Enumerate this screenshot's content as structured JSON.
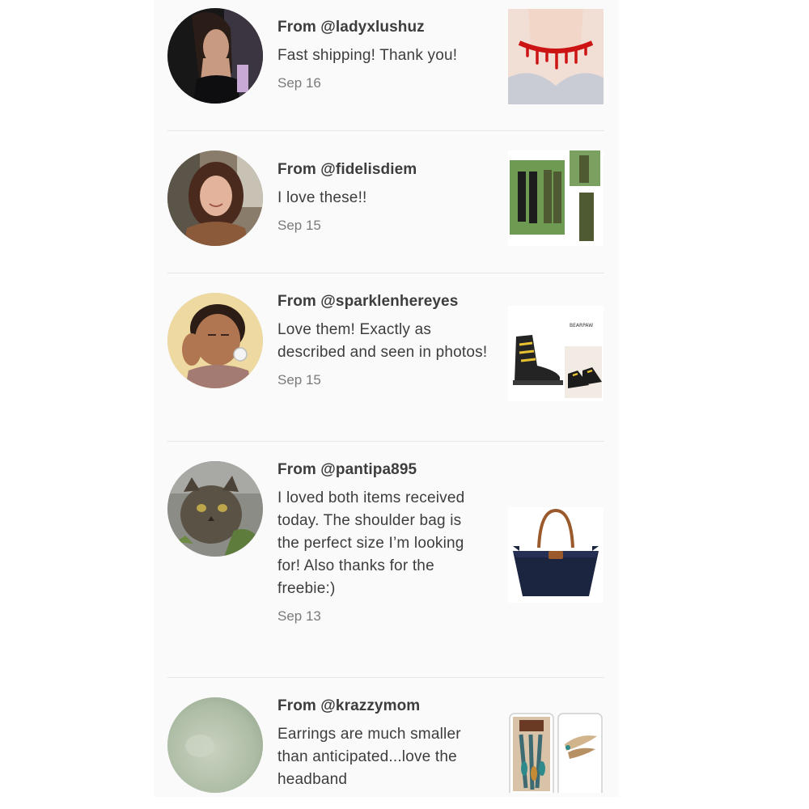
{
  "reviews": [
    {
      "from": "From @ladyxlushuz",
      "message": "Fast shipping! Thank you!",
      "date": "Sep 16",
      "avatar": "woman-black-top-avatar",
      "thumbnail": "red-drip-choker-image"
    },
    {
      "from": "From @fidelisdiem",
      "message": "I love these!!",
      "date": "Sep 15",
      "avatar": "smiling-woman-avatar",
      "thumbnail": "green-overalls-image"
    },
    {
      "from": "From @sparklenhereyes",
      "message": "Love them! Exactly as described and seen in photos!",
      "date": "Sep 15",
      "avatar": "woman-selfie-avatar",
      "thumbnail": "black-yellow-boots-image"
    },
    {
      "from": "From @pantipa895",
      "message": "I loved both items received today. The shoulder bag is the perfect size I’m looking for! Also thanks for the freebie:)",
      "date": "Sep 13",
      "avatar": "tabby-cat-avatar",
      "thumbnail": "navy-shoulder-bag-image"
    },
    {
      "from": "From @krazzymom",
      "message": "Earrings are much smaller than anticipated...love the headband",
      "date": "",
      "avatar": "blurry-avatar",
      "thumbnail": "feather-earrings-headband-image"
    }
  ]
}
